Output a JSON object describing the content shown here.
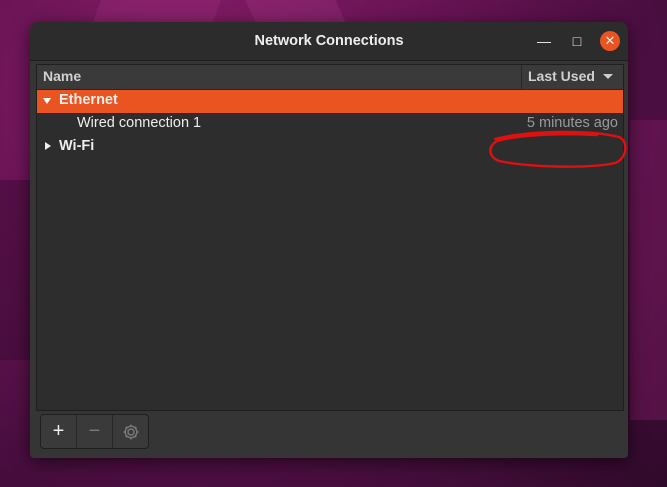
{
  "window": {
    "title": "Network Connections"
  },
  "window_controls": {
    "minimize": "—",
    "maximize": "□",
    "close": "✕"
  },
  "list": {
    "columns": {
      "name": "Name",
      "last_used": "Last Used"
    },
    "groups": [
      {
        "label": "Ethernet",
        "expanded": true,
        "selected": true,
        "connections": [
          {
            "name": "Wired connection 1",
            "last_used": "5 minutes ago"
          }
        ]
      },
      {
        "label": "Wi-Fi",
        "expanded": false,
        "selected": false,
        "connections": []
      }
    ]
  },
  "toolbar": {
    "add": "+",
    "remove": "−",
    "settings_icon": "gear-icon"
  },
  "colors": {
    "accent": "#e95420",
    "annotation": "#e01010"
  }
}
